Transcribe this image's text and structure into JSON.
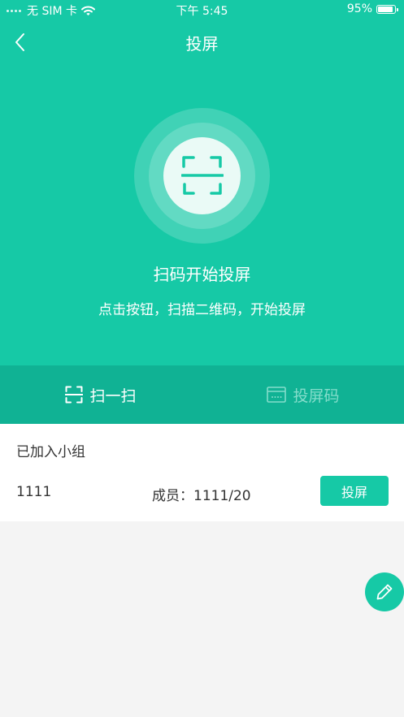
{
  "status_bar": {
    "carrier": "无 SIM 卡",
    "time": "下午 5:45",
    "battery_text": "95%",
    "battery_level": 0.95,
    "icons": [
      "signal-dots-icon",
      "wifi-icon",
      "battery-icon"
    ]
  },
  "nav": {
    "back_icon": "chevron-left-icon",
    "title": "投屏"
  },
  "hero": {
    "scan_icon": "scan-frame-icon",
    "title": "扫码开始投屏",
    "subtitle": "点击按钮，扫描二维码，开始投屏"
  },
  "tabs": [
    {
      "label": "扫一扫",
      "icon": "scan-frame-icon",
      "active": true
    },
    {
      "label": "投屏码",
      "icon": "keyboard-icon",
      "active": false
    }
  ],
  "group": {
    "heading": "已加入小组",
    "name": "1111",
    "members": "成员：1111/20",
    "cast_button": "投屏"
  },
  "fab": {
    "icon": "pencil-icon"
  },
  "colors": {
    "primary": "#16c9a6",
    "tab_bar": "#10b294",
    "inactive_tab": "#84ddcb",
    "background": "#f4f4f4",
    "card": "#ffffff",
    "text": "#333333"
  }
}
